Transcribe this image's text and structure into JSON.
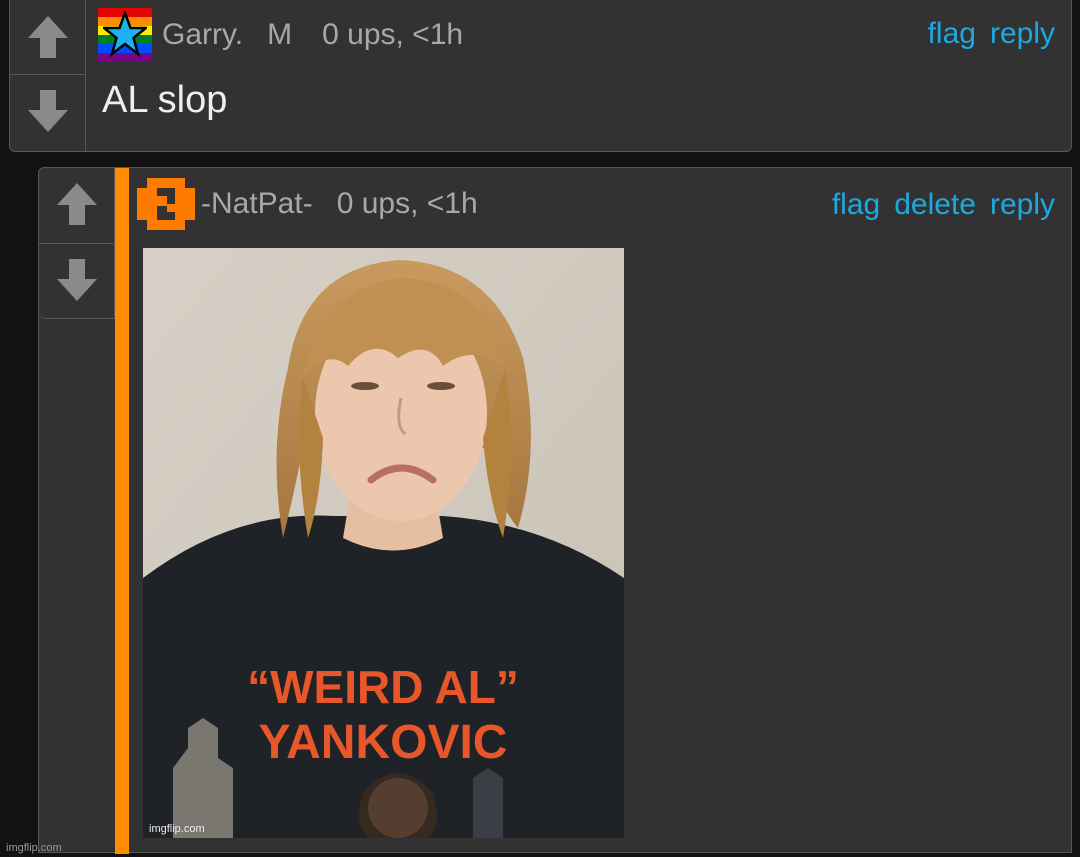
{
  "comments": [
    {
      "username": "Garry.",
      "badge": "M",
      "ups": "0 ups, <1h",
      "actions": [
        "flag",
        "reply"
      ],
      "text": "AL slop",
      "avatar_icon": "rainbow-flag-star-icon"
    },
    {
      "username": "-NatPat-",
      "ups": "0 ups, <1h",
      "actions": [
        "flag",
        "delete",
        "reply"
      ],
      "avatar_icon": "orange-pixel-logo-icon",
      "image": {
        "shirt_line1": "“WEIRD AL”",
        "shirt_line2": "YANKOVIC",
        "watermark": "imgflip.com"
      }
    }
  ],
  "footer": {
    "site": "imgflip.com"
  },
  "colors": {
    "background": "#121212",
    "panel": "#323232",
    "border": "#585858",
    "link": "#1ea8e0",
    "meta_text": "#a8a8a8",
    "reply_stripe": "#ff8c00"
  }
}
